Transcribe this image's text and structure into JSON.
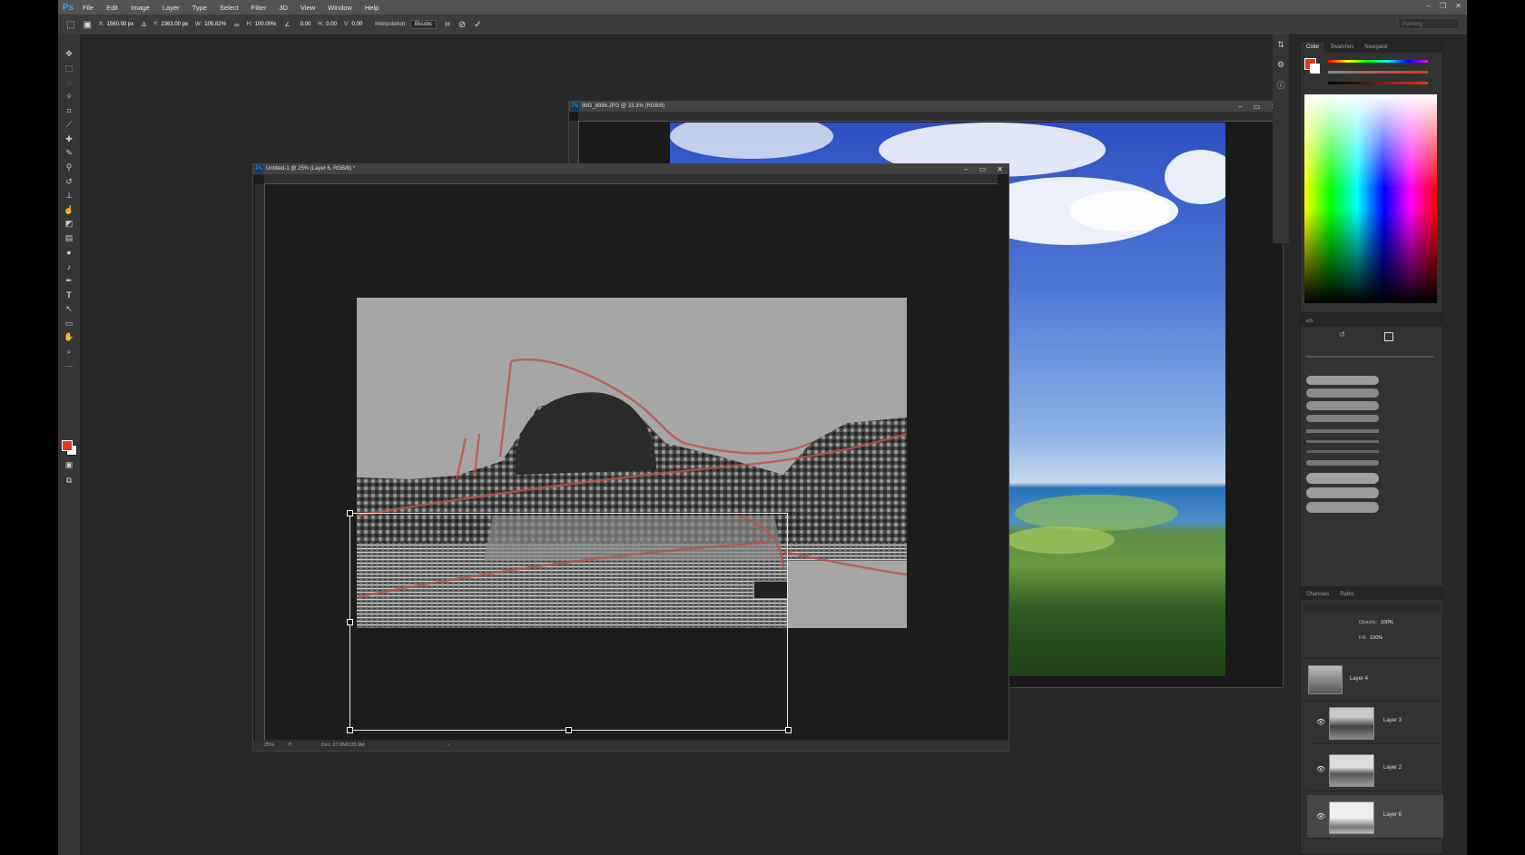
{
  "menu": {
    "logo": "Ps",
    "items": [
      "File",
      "Edit",
      "Image",
      "Layer",
      "Type",
      "Select",
      "Filter",
      "3D",
      "View",
      "Window",
      "Help"
    ]
  },
  "window_controls": [
    "–",
    "❐",
    "✕"
  ],
  "options": {
    "x_label": "X:",
    "x_value": "1560.00 px",
    "y_label": "Y:",
    "y_value": "2363.00 px",
    "w_label": "W:",
    "w_value": "105.82%",
    "h_label": "H:",
    "h_value": "100.00%",
    "angle_value": "0.00",
    "hskew_label": "H:",
    "hskew_value": "0.00",
    "vskew_label": "V:",
    "vskew_value": "0.00",
    "interp_label": "Interpolation:",
    "interp_value": "Bicubic",
    "workspace": "Painting"
  },
  "doc_back": {
    "title": "IMG_8986.JPG @ 33.3% (RGB/8)"
  },
  "doc_front": {
    "title": "Untitled-1 @ 25% (Layer 6, RGB/8) *",
    "zoom": "25%",
    "doc_info": "Doc: 27.8M/135.9M"
  },
  "color_panel": {
    "tabs": [
      "Color",
      "Swatches",
      "Navigator"
    ],
    "fg_color": "#e03a1a"
  },
  "channels_panel": {
    "tabs": [
      "Channels",
      "Paths"
    ],
    "opacity_label": "Opacity:",
    "opacity_value": "100%",
    "fill_label": "Fill:",
    "fill_value": "100%"
  },
  "layers": [
    {
      "name": "Layer 4",
      "visible": false,
      "selected": false
    },
    {
      "name": "Layer 3",
      "visible": true,
      "selected": false
    },
    {
      "name": "Layer 2",
      "visible": true,
      "selected": false
    },
    {
      "name": "Layer 6",
      "visible": true,
      "selected": true
    }
  ]
}
